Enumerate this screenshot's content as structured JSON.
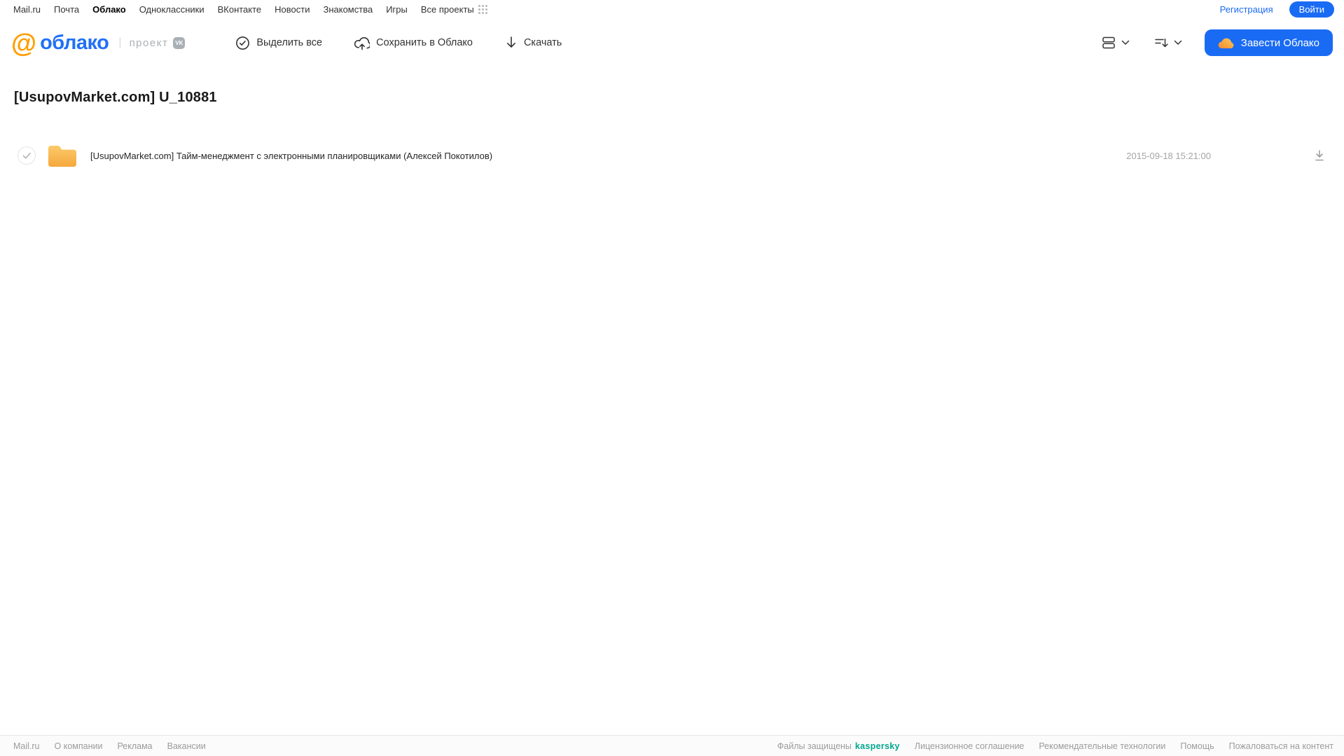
{
  "colors": {
    "accent_blue": "#1A6BF3",
    "logo_orange": "#FF9E00",
    "logo_blue": "#2170F6",
    "folder_yellow": "#FBBE55",
    "kaspersky_green": "#00A88E"
  },
  "topbar": {
    "links": [
      "Mail.ru",
      "Почта",
      "Облако",
      "Одноклассники",
      "ВКонтакте",
      "Новости",
      "Знакомства",
      "Игры",
      "Все проекты"
    ],
    "active_link": "Облако",
    "registration": "Регистрация",
    "login": "Войти"
  },
  "header": {
    "logo_at": "@",
    "logo_text": "облако",
    "project_label": "проект",
    "vk_badge": "VK",
    "toolbar": {
      "select_all": "Выделить все",
      "save_to_cloud": "Сохранить в Облако",
      "download": "Скачать"
    },
    "create_cloud_button": "Завести Облако"
  },
  "main": {
    "title": "[UsupovMarket.com] U_10881",
    "files": [
      {
        "type": "folder",
        "name": "[UsupovMarket.com] Тайм-менеджмент с электронными планировщиками (Алексей Покотилов)",
        "date": "2015-09-18 15:21:00"
      }
    ]
  },
  "footer": {
    "links_left": [
      "Mail.ru",
      "О компании",
      "Реклама",
      "Вакансии"
    ],
    "protected_label": "Файлы защищены",
    "protected_brand": "kaspersky",
    "links_right": [
      "Лицензионное соглашение",
      "Рекомендательные технологии",
      "Помощь",
      "Пожаловаться на контент"
    ]
  }
}
